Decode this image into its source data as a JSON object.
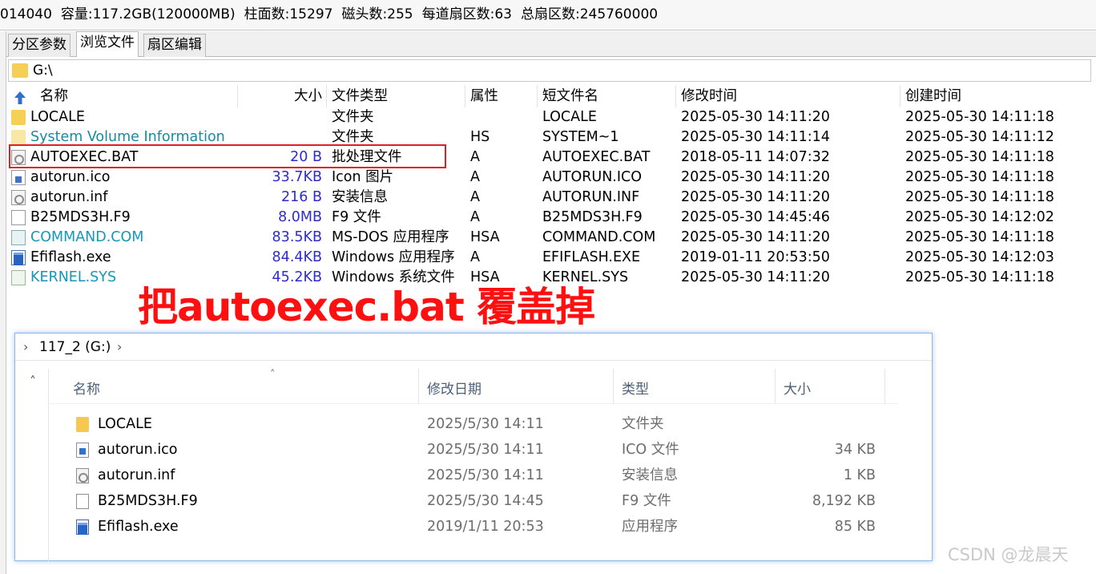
{
  "info_bar": {
    "items": [
      "014040",
      "容量:117.2GB(120000MB)",
      "柱面数:15297",
      "磁头数:255",
      "每道扇区数:63",
      "总扇区数:245760000"
    ]
  },
  "tabs": [
    {
      "label": "分区参数"
    },
    {
      "label": "浏览文件",
      "active": true
    },
    {
      "label": "扇区编辑"
    }
  ],
  "path": "G:\\",
  "columns": {
    "name": "名称",
    "size": "大小",
    "type": "文件类型",
    "attr": "属性",
    "short": "短文件名",
    "modified": "修改时间",
    "created": "创建时间"
  },
  "files": [
    {
      "name": "LOCALE",
      "size": "",
      "type": "文件夹",
      "attr": "",
      "short": "LOCALE",
      "modified": "2025-05-30 14:11:20",
      "created": "2025-05-30 14:11:18",
      "icon": "folder-icon"
    },
    {
      "name": "System Volume Information",
      "size": "",
      "type": "文件夹",
      "attr": "HS",
      "short": "SYSTEM~1",
      "modified": "2025-05-30 14:11:14",
      "created": "2025-05-30 14:11:12",
      "icon": "hidden-folder-icon"
    },
    {
      "name": "AUTOEXEC.BAT",
      "size": "20 B",
      "type": "批处理文件",
      "attr": "A",
      "short": "AUTOEXEC.BAT",
      "modified": "2018-05-11 14:07:32",
      "created": "2025-05-30 14:11:18",
      "icon": "batch-file-icon"
    },
    {
      "name": "autorun.ico",
      "size": "33.7KB",
      "type": "Icon 图片",
      "attr": "A",
      "short": "AUTORUN.ICO",
      "modified": "2025-05-30 14:11:20",
      "created": "2025-05-30 14:11:18",
      "icon": "image-file-icon"
    },
    {
      "name": "autorun.inf",
      "size": "216 B",
      "type": "安装信息",
      "attr": "A",
      "short": "AUTORUN.INF",
      "modified": "2025-05-30 14:11:20",
      "created": "2025-05-30 14:11:18",
      "icon": "setup-file-icon"
    },
    {
      "name": "B25MDS3H.F9",
      "size": "8.0MB",
      "type": "F9 文件",
      "attr": "A",
      "short": "B25MDS3H.F9",
      "modified": "2025-05-30 14:45:46",
      "created": "2025-05-30 14:12:02",
      "icon": "blank-file-icon"
    },
    {
      "name": "COMMAND.COM",
      "size": "83.5KB",
      "type": "MS-DOS 应用程序",
      "attr": "HSA",
      "short": "COMMAND.COM",
      "modified": "2025-05-30 14:11:20",
      "created": "2025-05-30 14:11:18",
      "icon": "dos-app-icon"
    },
    {
      "name": "Efiflash.exe",
      "size": "84.4KB",
      "type": "Windows 应用程序",
      "attr": "A",
      "short": "EFIFLASH.EXE",
      "modified": "2019-01-11 20:53:50",
      "created": "2025-05-30 14:12:03",
      "icon": "exe-file-icon"
    },
    {
      "name": "KERNEL.SYS",
      "size": "45.2KB",
      "type": "Windows 系统文件",
      "attr": "HSA",
      "short": "KERNEL.SYS",
      "modified": "2025-05-30 14:11:20",
      "created": "2025-05-30 14:11:18",
      "icon": "system-file-icon"
    }
  ],
  "annotation": "把autoexec.bat 覆盖掉",
  "explorer": {
    "breadcrumb": "117_2 (G:)",
    "columns": {
      "name": "名称",
      "date": "修改日期",
      "type": "类型",
      "size": "大小"
    },
    "files": [
      {
        "name": "LOCALE",
        "date": "2025/5/30 14:11",
        "type": "文件夹",
        "size": "",
        "icon": "folder-icon"
      },
      {
        "name": "autorun.ico",
        "date": "2025/5/30 14:11",
        "type": "ICO 文件",
        "size": "34 KB",
        "icon": "image-file-icon"
      },
      {
        "name": "autorun.inf",
        "date": "2025/5/30 14:11",
        "type": "安装信息",
        "size": "1 KB",
        "icon": "setup-file-icon"
      },
      {
        "name": "B25MDS3H.F9",
        "date": "2025/5/30 14:45",
        "type": "F9 文件",
        "size": "8,192 KB",
        "icon": "blank-file-icon"
      },
      {
        "name": "Efiflash.exe",
        "date": "2019/1/11 20:53",
        "type": "应用程序",
        "size": "85 KB",
        "icon": "exe-file-icon"
      }
    ]
  },
  "watermark": "CSDN @龙晨天",
  "colors": {
    "highlight_box": "#e02020",
    "annotation": "#ff1010",
    "size_text": "#2d2dcf",
    "hidden_text": "#188aa0"
  }
}
